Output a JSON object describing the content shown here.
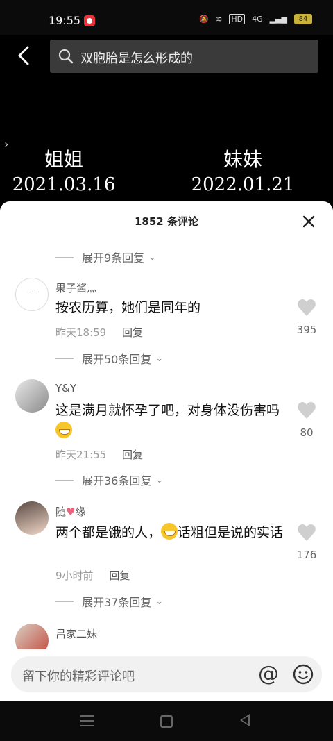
{
  "status_bar": {
    "time": "19:55",
    "hd": "HD",
    "signal": "4G",
    "battery": "84"
  },
  "search": {
    "query": "双胞胎是怎么形成的"
  },
  "video": {
    "left_label": "姐姐",
    "left_date": "2021.03.16",
    "right_label": "妹妹",
    "right_date": "2022.01.21"
  },
  "comments_sheet": {
    "title": "1852 条评论",
    "top_expand": "展开9条回复",
    "comments": [
      {
        "user": "果子酱灬",
        "text": "按农历算，她们是同年的",
        "time": "昨天18:59",
        "reply": "回复",
        "likes": "395",
        "expand": "展开50条回复"
      },
      {
        "user": "Y&Y",
        "text": "这是满月就怀孕了吧，对身体没伤害吗",
        "time": "昨天21:55",
        "reply": "回复",
        "likes": "80",
        "expand": "展开36条回复"
      },
      {
        "user_a": "随",
        "user_b": "缘",
        "text_a": "两个都是饿的人，",
        "text_b": "话粗但是说的实话",
        "time": "9小时前",
        "reply": "回复",
        "likes": "176",
        "expand": "展开37条回复"
      },
      {
        "user": "吕家二妹"
      }
    ]
  },
  "input_bar": {
    "placeholder": "留下你的精彩评论吧",
    "at": "@"
  }
}
